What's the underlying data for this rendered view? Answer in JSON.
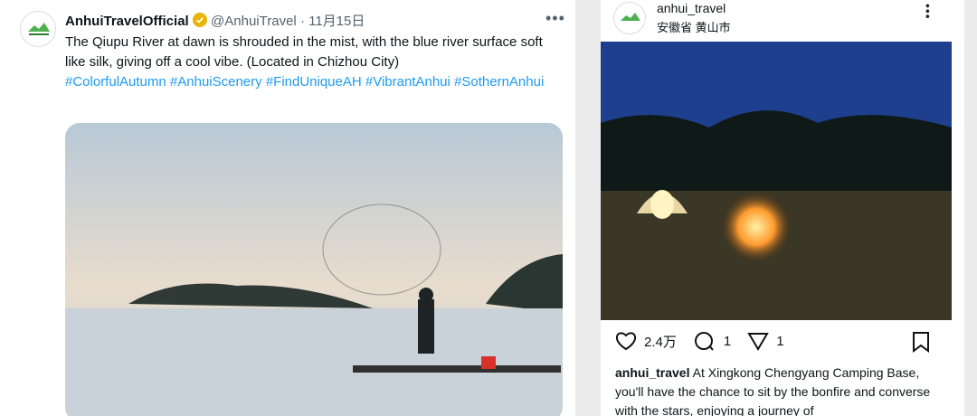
{
  "tweet": {
    "name": "AnhuiTravelOfficial",
    "handle": "@AnhuiTravel",
    "sep": "·",
    "date": "11月15日",
    "text": "The Qiupu River at dawn is shrouded in the mist, with the blue river surface soft like silk, giving off a cool vibe. (Located in Chizhou City)",
    "hashtags": [
      "#ColorfulAutumn",
      "#AnhuiScenery",
      "#FindUniqueAH",
      "#VibrantAnhui",
      "#SothernAnhui"
    ]
  },
  "instagram": {
    "username": "anhui_travel",
    "location": "安徽省 黄山市",
    "likes": "2.4万",
    "comments": "1",
    "shares": "1",
    "caption_user": "anhui_travel",
    "caption": "At Xingkong Chengyang Camping Base, you'll have the chance to sit by the bonfire and converse with the stars, enjoying a journey of"
  },
  "colors": {
    "link": "#1d9bf0",
    "verified": "#e8b400"
  }
}
